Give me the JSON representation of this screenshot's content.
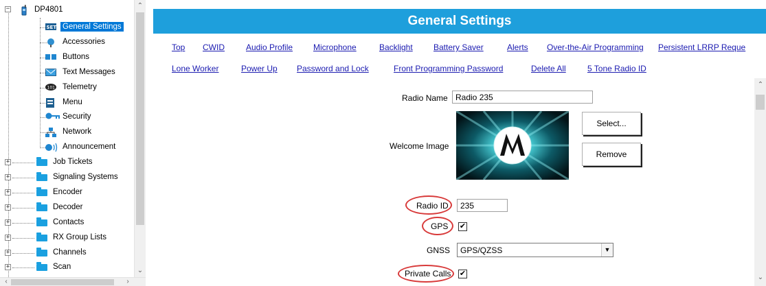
{
  "tree": {
    "root": {
      "label": "DP4801",
      "expander": "−"
    },
    "items": [
      {
        "label": "General Settings",
        "icon": "settings-icon",
        "selected": true
      },
      {
        "label": "Accessories",
        "icon": "accessories-icon"
      },
      {
        "label": "Buttons",
        "icon": "buttons-icon"
      },
      {
        "label": "Text Messages",
        "icon": "envelope-icon"
      },
      {
        "label": "Telemetry",
        "icon": "telemetry-icon"
      },
      {
        "label": "Menu",
        "icon": "menu-icon"
      },
      {
        "label": "Security",
        "icon": "key-icon"
      },
      {
        "label": "Network",
        "icon": "network-icon"
      },
      {
        "label": "Announcement",
        "icon": "speaker-icon"
      },
      {
        "label": "Job Tickets",
        "icon": "folder-icon",
        "expander": "+"
      },
      {
        "label": "Signaling Systems",
        "icon": "folder-icon",
        "expander": "+"
      },
      {
        "label": "Encoder",
        "icon": "folder-icon",
        "expander": "+"
      },
      {
        "label": "Decoder",
        "icon": "folder-icon",
        "expander": "+"
      },
      {
        "label": "Contacts",
        "icon": "folder-icon",
        "expander": "+"
      },
      {
        "label": "RX Group Lists",
        "icon": "folder-icon",
        "expander": "+"
      },
      {
        "label": "Channels",
        "icon": "folder-icon",
        "expander": "+"
      },
      {
        "label": "Scan",
        "icon": "folder-icon",
        "expander": "+"
      }
    ]
  },
  "header": {
    "title": "General Settings"
  },
  "links": {
    "row1": [
      "Top",
      "CWID",
      "Audio Profile",
      "Microphone",
      "Backlight",
      "Battery Saver",
      "Alerts",
      "Over-the-Air Programming",
      "Persistent LRRP Reque"
    ],
    "row2": [
      "Lone Worker",
      "Power Up",
      "Password and Lock",
      "Front Programming Password",
      "Delete All",
      "5 Tone Radio ID"
    ]
  },
  "form": {
    "radio_name": {
      "label": "Radio Name",
      "value": "Radio 235"
    },
    "welcome_image": {
      "label": "Welcome Image",
      "select_label": "Select...",
      "remove_label": "Remove"
    },
    "radio_id": {
      "label": "Radio ID",
      "value": "235"
    },
    "gps": {
      "label": "GPS",
      "checked": true,
      "mark": "✔"
    },
    "gnss": {
      "label": "GNSS",
      "value": "GPS/QZSS"
    },
    "private_calls": {
      "label": "Private Calls",
      "checked": true,
      "mark": "✔"
    }
  },
  "colors": {
    "header_bg": "#1e9fdc",
    "selection": "#0078d7",
    "highlight_oval": "#d83a3a",
    "link": "#1a1ab0"
  }
}
